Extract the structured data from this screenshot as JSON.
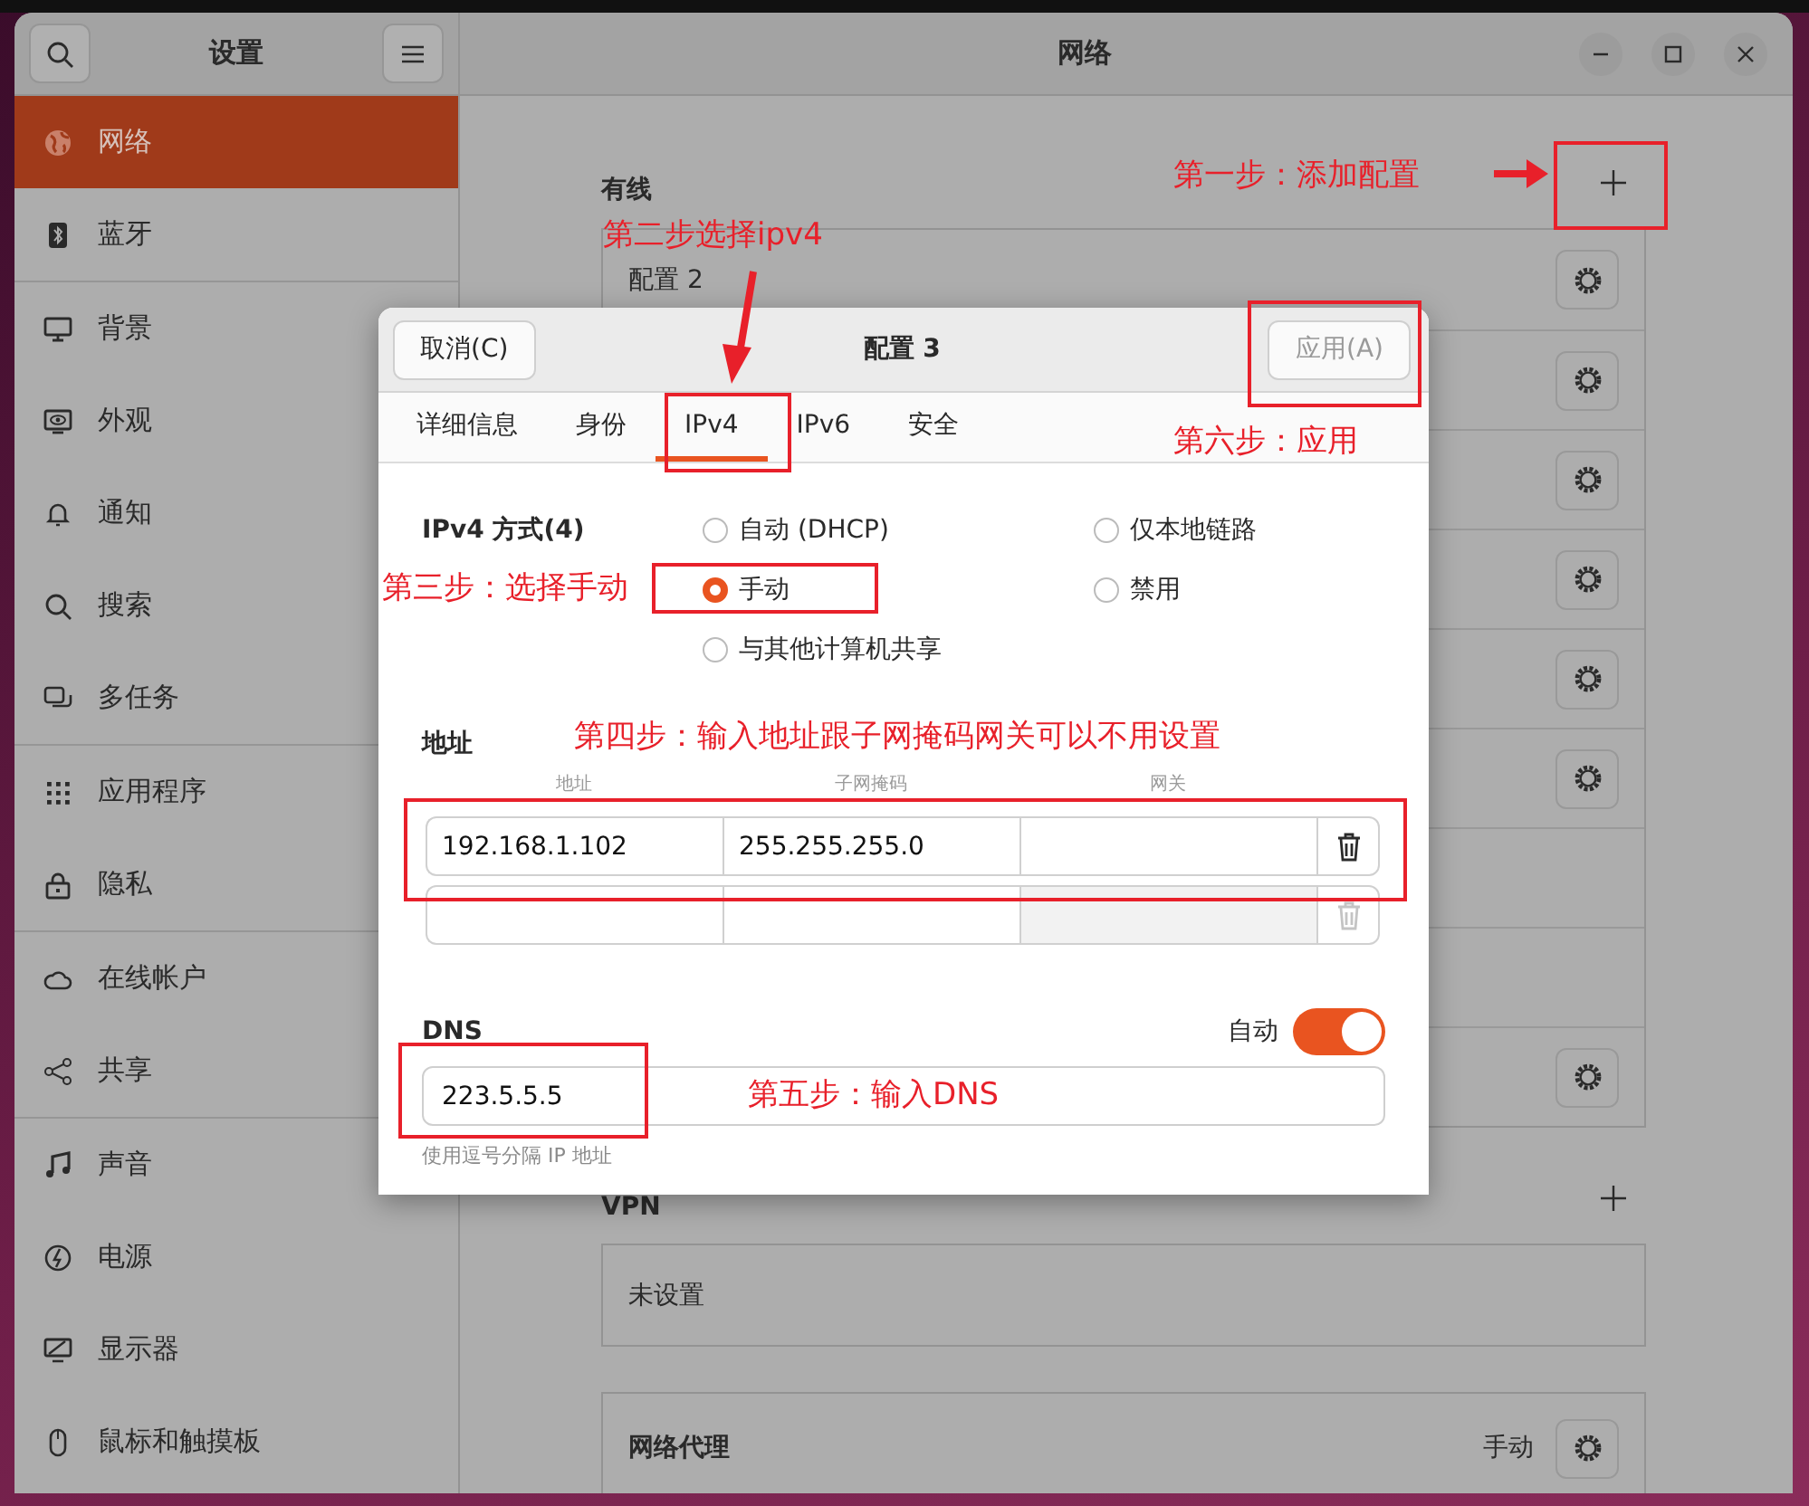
{
  "sidebar": {
    "title": "设置",
    "groups": [
      [
        {
          "label": "网络",
          "selected": true
        },
        {
          "label": "蓝牙",
          "selected": false
        }
      ],
      [
        {
          "label": "背景",
          "selected": false
        },
        {
          "label": "外观",
          "selected": false
        },
        {
          "label": "通知",
          "selected": false
        },
        {
          "label": "搜索",
          "selected": false
        },
        {
          "label": "多任务",
          "selected": false
        }
      ],
      [
        {
          "label": "应用程序",
          "selected": false
        },
        {
          "label": "隐私",
          "selected": false
        }
      ],
      [
        {
          "label": "在线帐户",
          "selected": false
        },
        {
          "label": "共享",
          "selected": false
        }
      ],
      [
        {
          "label": "声音",
          "selected": false
        },
        {
          "label": "电源",
          "selected": false
        },
        {
          "label": "显示器",
          "selected": false
        },
        {
          "label": "鼠标和触摸板",
          "selected": false
        }
      ]
    ]
  },
  "main": {
    "title": "网络",
    "wired": {
      "heading": "有线",
      "rows": [
        {
          "label": "配置 2",
          "settings": true
        },
        {
          "settings": true
        },
        {
          "settings": true
        },
        {
          "settings": true
        },
        {
          "settings": true
        },
        {
          "settings": true
        },
        {
          "settings": false
        },
        {
          "settings": false
        },
        {
          "settings": true
        }
      ]
    },
    "vpn": {
      "heading": "VPN",
      "rows": [
        {
          "label": "未设置"
        }
      ]
    },
    "proxy": {
      "label": "网络代理",
      "value": "手动"
    }
  },
  "dialog": {
    "cancel": "取消(C)",
    "title": "配置 3",
    "apply": {
      "label": "应用(A)",
      "disabled": true
    },
    "tabs": [
      {
        "label": "详细信息",
        "selected": false
      },
      {
        "label": "身份",
        "selected": false
      },
      {
        "label": "IPv4",
        "selected": true
      },
      {
        "label": "IPv6",
        "selected": false
      },
      {
        "label": "安全",
        "selected": false
      }
    ],
    "method": {
      "label": "IPv4 方式(4)",
      "options": [
        {
          "label": "自动 (DHCP)",
          "selected": false
        },
        {
          "label": "仅本地链路",
          "selected": false
        },
        {
          "label": "手动",
          "selected": true
        },
        {
          "label": "禁用",
          "selected": false
        },
        {
          "label": "与其他计算机共享",
          "selected": false
        }
      ]
    },
    "addresses": {
      "heading": "地址",
      "columns": [
        "地址",
        "子网掩码",
        "网关"
      ],
      "rows": [
        {
          "address": "192.168.1.102",
          "netmask": "255.255.255.0",
          "gateway_disabled": false,
          "delete_disabled": false
        },
        {
          "gateway_disabled": true,
          "delete_disabled": true
        }
      ]
    },
    "dns": {
      "heading": "DNS",
      "auto_label": "自动",
      "auto": true,
      "value": "223.5.5.5",
      "hint": "使用逗号分隔 IP 地址"
    }
  },
  "annotations": [
    {
      "text": "第一步：添加配置"
    },
    {
      "text": "第二步选择ipv4"
    },
    {
      "text": "第三步：选择手动"
    },
    {
      "text": "第四步：输入地址跟子网掩码网关可以不用设置"
    },
    {
      "text": "第五步：输入DNS"
    },
    {
      "text": "第六步：应用"
    }
  ]
}
